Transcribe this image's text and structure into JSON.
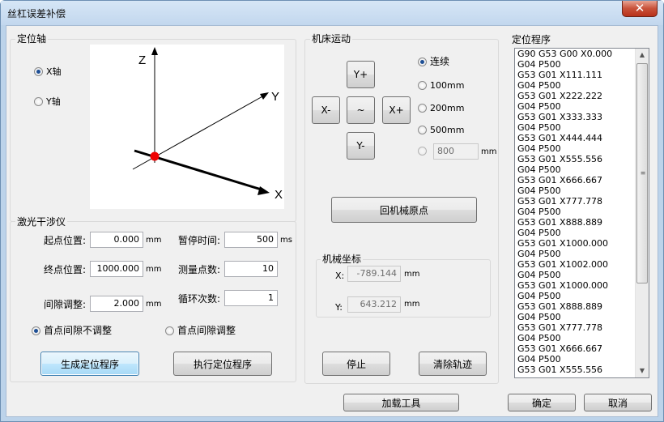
{
  "window": {
    "title": "丝杠误差补偿",
    "close": "✕"
  },
  "axis_group": {
    "title": "定位轴",
    "radio_x": "X轴",
    "radio_y": "Y轴",
    "selected": "X轴",
    "axis_labels": {
      "z": "Z",
      "y": "Y",
      "x": "X"
    }
  },
  "laser": {
    "title": "激光干涉仪",
    "start_label": "起点位置:",
    "start_value": "0.000",
    "start_unit": "mm",
    "end_label": "终点位置:",
    "end_value": "1000.000",
    "end_unit": "mm",
    "gap_label": "间隙调整:",
    "gap_value": "2.000",
    "gap_unit": "mm",
    "pause_label": "暂停时间:",
    "pause_value": "500",
    "pause_unit": "ms",
    "points_label": "测量点数:",
    "points_value": "10",
    "loops_label": "循环次数:",
    "loops_value": "1",
    "radio_no_adjust": "首点间隙不调整",
    "radio_adjust": "首点间隙调整",
    "selected": "首点间隙不调整",
    "gen_button": "生成定位程序",
    "exec_button": "执行定位程序"
  },
  "machine": {
    "title": "机床运动",
    "y_plus": "Y+",
    "y_minus": "Y-",
    "x_plus": "X+",
    "x_minus": "X-",
    "stop_jog": "~",
    "step_options": [
      "连续",
      "100mm",
      "200mm",
      "500mm"
    ],
    "selected": "连续",
    "custom_value": "800",
    "custom_unit": "mm",
    "home_button": "回机械原点"
  },
  "coords": {
    "title": "机械坐标",
    "x_label": "X:",
    "x_value": "-789.144",
    "x_unit": "mm",
    "y_label": "Y:",
    "y_value": "643.212",
    "y_unit": "mm"
  },
  "bottom": {
    "stop": "停止",
    "clear": "清除轨迹",
    "load_tool": "加载工具",
    "ok": "确定",
    "cancel": "取消"
  },
  "program": {
    "title": "定位程序",
    "lines": [
      "G90 G53 G00 X0.000",
      "G04 P500",
      "G53 G01 X111.111",
      "G04 P500",
      "G53 G01 X222.222",
      "G04 P500",
      "G53 G01 X333.333",
      "G04 P500",
      "G53 G01 X444.444",
      "G04 P500",
      "G53 G01 X555.556",
      "G04 P500",
      "G53 G01 X666.667",
      "G04 P500",
      "G53 G01 X777.778",
      "G04 P500",
      "G53 G01 X888.889",
      "G04 P500",
      "G53 G01 X1000.000",
      "G04 P500",
      "G53 G01 X1002.000",
      "G04 P500",
      "G53 G01 X1000.000",
      "G04 P500",
      "G53 G01 X888.889",
      "G04 P500",
      "G53 G01 X777.778",
      "G04 P500",
      "G53 G01 X666.667",
      "G04 P500",
      "G53 G01 X555.556"
    ]
  }
}
